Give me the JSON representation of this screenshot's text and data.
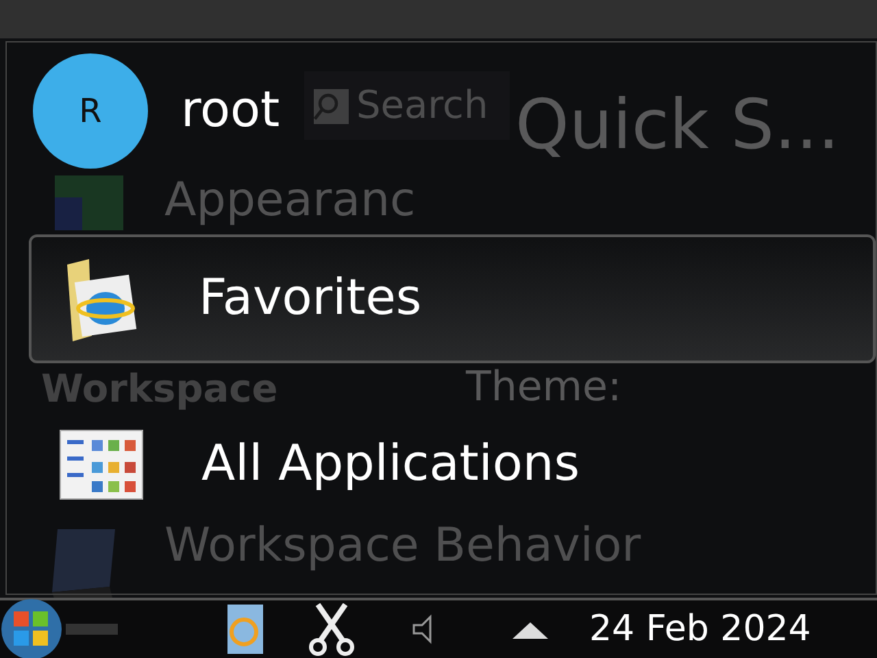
{
  "background_window": {
    "search_placeholder": "Search",
    "title": "Quick S...",
    "sections": [
      {
        "label": "Appearanc"
      },
      {
        "label": "Workspace"
      },
      {
        "label": "Workspace Behavior"
      }
    ],
    "field_label": "Theme:"
  },
  "menu": {
    "user": {
      "initial": "R",
      "name": "root"
    },
    "items": [
      {
        "label": "Favorites",
        "kind": "favorites",
        "selected": true
      },
      {
        "label": "All Applications",
        "kind": "apps",
        "selected": false
      }
    ]
  },
  "taskbar": {
    "date": "24 Feb 2024"
  }
}
